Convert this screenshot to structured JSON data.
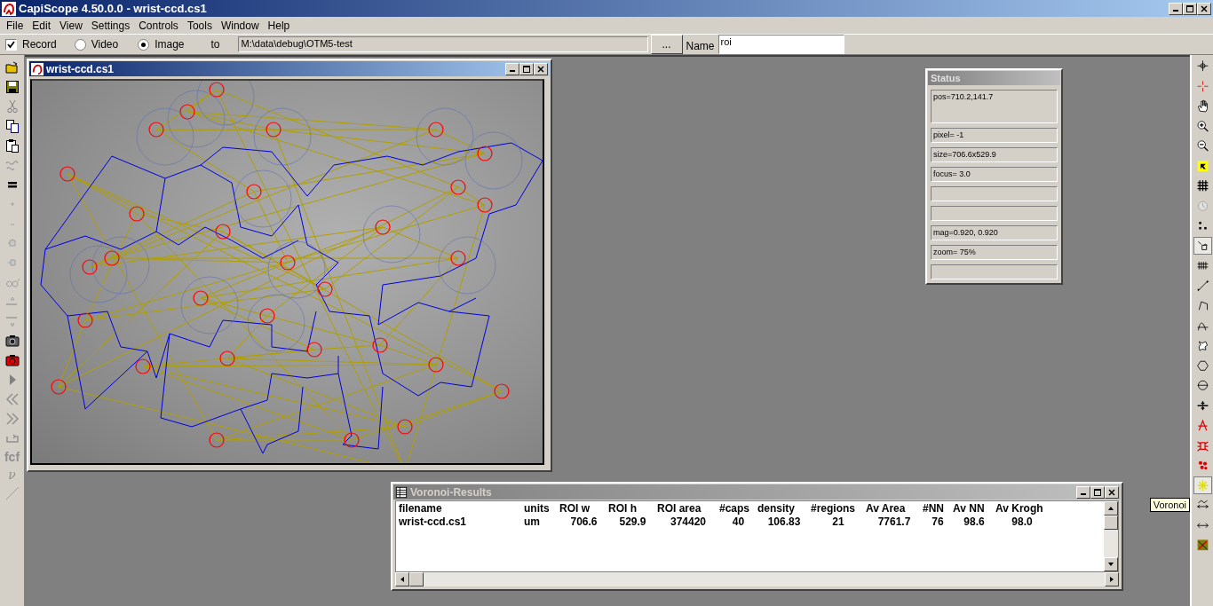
{
  "window": {
    "title": "CapiScope 4.50.0.0 - wrist-ccd.cs1"
  },
  "menu": [
    "File",
    "Edit",
    "View",
    "Settings",
    "Controls",
    "Tools",
    "Window",
    "Help"
  ],
  "toolbar": {
    "record": {
      "label": "Record",
      "checked": true
    },
    "modes": [
      {
        "label": "Video",
        "selected": false
      },
      {
        "label": "Image",
        "selected": true
      }
    ],
    "to_label": "to",
    "path": "M:\\data\\debug\\OTM5-test",
    "browse": "...",
    "name_label": "Name",
    "name_value": "roi"
  },
  "left_toolbar": {
    "text_tools": [
      "fcf",
      "ν"
    ]
  },
  "image_window": {
    "title": "wrist-ccd.cs1"
  },
  "status": {
    "title": "Status",
    "fields": [
      {
        "kind": "tall",
        "text": "pos=710.2,141.7"
      },
      {
        "kind": "text",
        "text": "pixel= -1"
      },
      {
        "kind": "text",
        "text": "size=706.6x529.9"
      },
      {
        "kind": "text",
        "text": "focus=  3.0"
      },
      {
        "kind": "empty"
      },
      {
        "kind": "empty"
      },
      {
        "kind": "text",
        "text": "mag=0.920, 0.920"
      },
      {
        "kind": "text",
        "text": "zoom=  75%"
      },
      {
        "kind": "empty"
      }
    ]
  },
  "results": {
    "title": "Voronoi-Results",
    "columns": [
      "filename",
      "units",
      "ROI w",
      "ROI h",
      "ROI area",
      "#caps",
      "density",
      "#regions",
      "Av Area",
      "#NN",
      "Av NN",
      "Av Krogh"
    ],
    "rows": [
      [
        "wrist-ccd.cs1",
        "um",
        "706.6",
        "529.9",
        "374420",
        "40",
        "106.83",
        "21",
        "7761.7",
        "76",
        "98.6",
        "98.0"
      ]
    ]
  },
  "right_toolbar": {
    "tools": [
      {
        "selected": false
      },
      {
        "selected": false
      },
      {
        "selected": false
      },
      {
        "selected": false
      },
      {
        "selected": false
      },
      {
        "selected": false
      },
      {
        "selected": false
      },
      {
        "selected": false
      },
      {
        "selected": false
      },
      {
        "selected": true
      },
      {
        "selected": false
      },
      {
        "selected": false
      },
      {
        "selected": false
      },
      {
        "selected": false
      },
      {
        "selected": false
      },
      {
        "selected": false
      },
      {
        "selected": false
      },
      {
        "selected": false
      },
      {
        "selected": false
      },
      {
        "selected": false
      },
      {
        "selected": false
      },
      {
        "selected": true
      },
      {
        "selected": false
      },
      {
        "selected": false
      },
      {
        "selected": false
      }
    ],
    "tooltip": "Voronoi"
  }
}
